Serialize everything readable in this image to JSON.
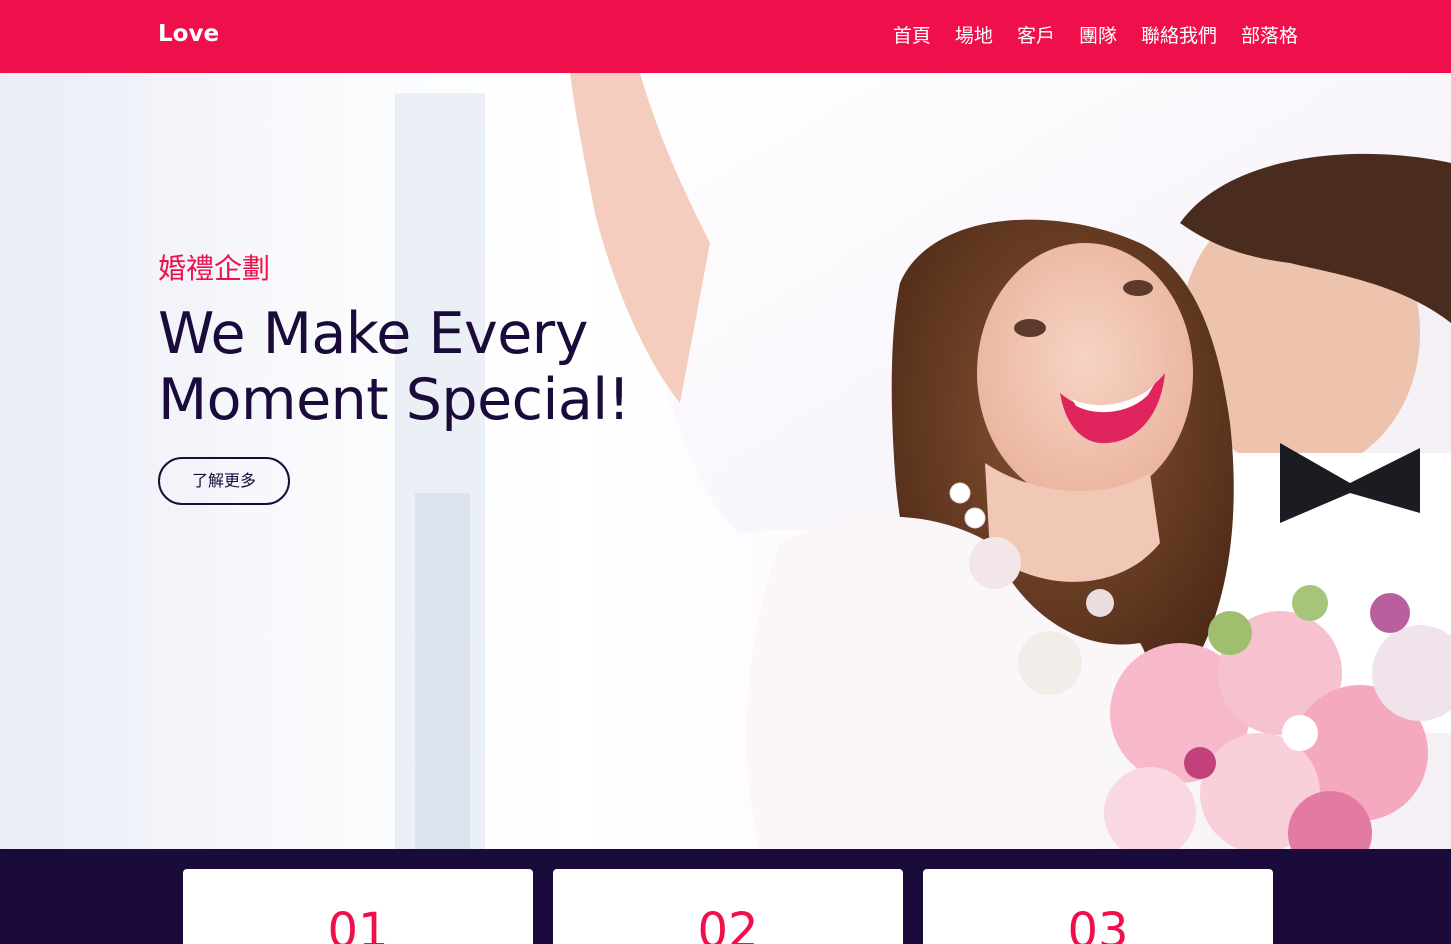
{
  "navbar": {
    "brand": "Love",
    "links": [
      "首頁",
      "場地",
      "客戶",
      "團隊",
      "聯絡我們",
      "部落格"
    ]
  },
  "hero": {
    "kicker": "婚禮企劃",
    "title_line1": "We Make Every",
    "title_line2": "Moment Special!",
    "button_label": "了解更多"
  },
  "features": {
    "cards": [
      {
        "number": "01"
      },
      {
        "number": "02"
      },
      {
        "number": "03"
      }
    ]
  },
  "colors": {
    "accent": "#ee0f4b",
    "dark": "#1a0b3b"
  }
}
